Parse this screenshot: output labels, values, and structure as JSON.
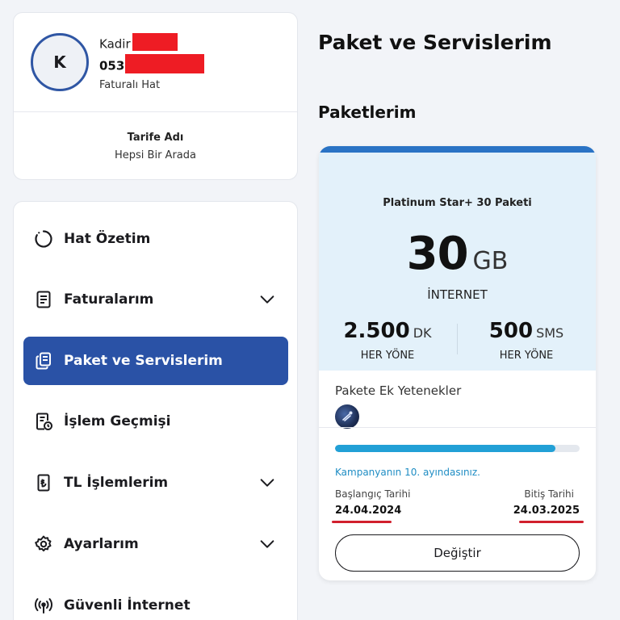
{
  "profile": {
    "avatar_initial": "K",
    "name": "Kadir",
    "phone_prefix": "053",
    "line_type": "Faturalı Hat",
    "tariff_label": "Tarife Adı",
    "tariff_value": "Hepsi Bir Arada"
  },
  "menu": {
    "items": [
      {
        "label": "Hat Özetim",
        "icon": "circle-loading-icon",
        "has_chevron": false,
        "active": false
      },
      {
        "label": "Faturalarım",
        "icon": "document-icon",
        "has_chevron": true,
        "active": false
      },
      {
        "label": "Paket ve Servislerim",
        "icon": "cards-icon",
        "has_chevron": false,
        "active": true
      },
      {
        "label": "İşlem Geçmişi",
        "icon": "history-document-icon",
        "has_chevron": false,
        "active": false
      },
      {
        "label": "TL İşlemlerim",
        "icon": "lira-document-icon",
        "has_chevron": true,
        "active": false
      },
      {
        "label": "Ayarlarım",
        "icon": "gear-icon",
        "has_chevron": true,
        "active": false
      },
      {
        "label": "Güvenli İnternet",
        "icon": "signal-icon",
        "has_chevron": false,
        "active": false
      }
    ]
  },
  "main": {
    "page_title": "Paket ve Servislerim",
    "section_title": "Paketlerim"
  },
  "package": {
    "name": "Platinum Star+ 30 Paketi",
    "internet_amount": "30",
    "internet_unit": "GB",
    "internet_label": "İNTERNET",
    "minutes_amount": "2.500",
    "minutes_unit": "DK",
    "minutes_label": "HER YÖNE",
    "sms_amount": "500",
    "sms_unit": "SMS",
    "sms_label": "HER YÖNE",
    "addons_label": "Pakete Ek Yetenekler",
    "progress_fraction": 0.9,
    "campaign_text": "Kampanyanın 10. ayındasınız.",
    "start_label": "Başlangıç Tarihi",
    "start_date": "24.04.2024",
    "end_label": "Bitiş Tarihi",
    "end_date": "24.03.2025",
    "change_button": "Değiştir"
  },
  "colors": {
    "accent_blue": "#2a52a6",
    "hero_bg": "#e3f1fa",
    "progress": "#22a0d6",
    "redaction": "#ee1c24"
  }
}
